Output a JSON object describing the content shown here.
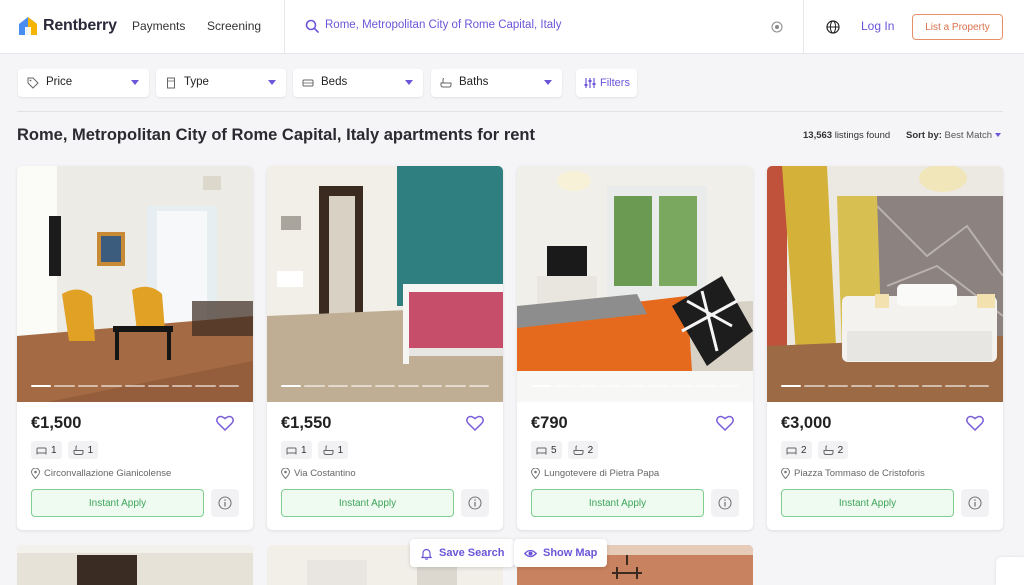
{
  "app": {
    "name": "Rentberry"
  },
  "nav": {
    "payments": "Payments",
    "screening": "Screening",
    "login": "Log In",
    "list_property": "List a Property"
  },
  "search": {
    "value": "Rome, Metropolitan City of Rome Capital, Italy"
  },
  "filters": {
    "price": "Price",
    "type": "Type",
    "beds": "Beds",
    "baths": "Baths",
    "more": "Filters"
  },
  "results": {
    "title": "Rome, Metropolitan City of Rome Capital, Italy apartments for rent",
    "count": "13,563",
    "count_suffix": " listings found",
    "sort_label": "Sort by:",
    "sort_value": "Best Match"
  },
  "listings": [
    {
      "price": "€1,500",
      "beds": "1",
      "baths": "1",
      "address": "Circonvallazione Gianicolense",
      "action": "Instant Apply"
    },
    {
      "price": "€1,550",
      "beds": "1",
      "baths": "1",
      "address": "Via Costantino",
      "action": "Instant Apply"
    },
    {
      "price": "€790",
      "beds": "5",
      "baths": "2",
      "address": "Lungotevere di Pietra Papa",
      "action": "Instant Apply"
    },
    {
      "price": "€3,000",
      "beds": "2",
      "baths": "2",
      "address": "Piazza Tommaso de Cristoforis",
      "action": "Instant Apply"
    }
  ],
  "floating": {
    "save_search": "Save Search",
    "show_map": "Show Map"
  },
  "colors": {
    "accent": "#6c55d8",
    "cta_border": "#e5906a",
    "apply_green": "#3ea55a",
    "heart": "#7b5fd9"
  }
}
